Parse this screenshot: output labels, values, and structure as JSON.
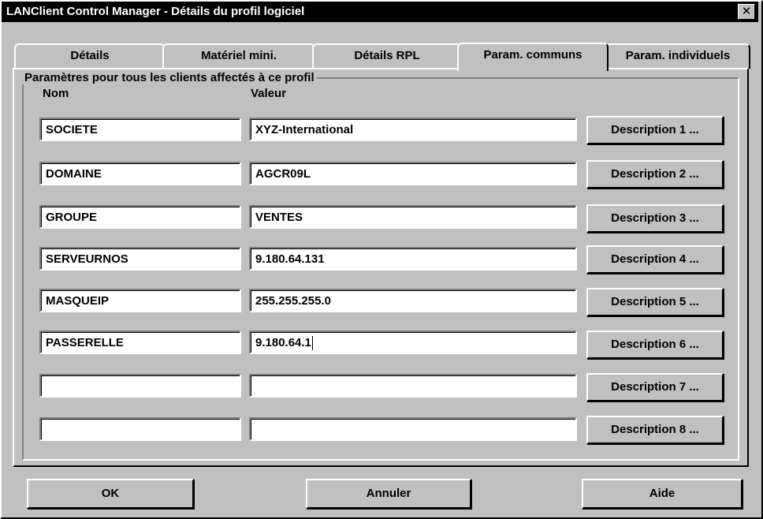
{
  "window": {
    "title": "LANClient Control Manager - Détails du profil logiciel",
    "close_glyph": "✕"
  },
  "tabs": [
    {
      "label": "Détails",
      "active": false
    },
    {
      "label": "Matériel mini.",
      "active": false
    },
    {
      "label": "Détails RPL",
      "active": false
    },
    {
      "label": "Param. communs",
      "active": true
    },
    {
      "label": "Param. individuels",
      "active": false
    }
  ],
  "group": {
    "label": "Paramètres pour tous les clients affectés à ce profil",
    "col_name": "Nom",
    "col_value": "Valeur"
  },
  "rows": [
    {
      "name": "SOCIETE",
      "value": "XYZ-International",
      "button": "Description 1 ..."
    },
    {
      "name": "DOMAINE",
      "value": "AGCR09L",
      "button": "Description 2 ..."
    },
    {
      "name": "GROUPE",
      "value": "VENTES",
      "button": "Description 3 ..."
    },
    {
      "name": "SERVEURNOS",
      "value": "9.180.64.131",
      "button": "Description 4 ..."
    },
    {
      "name": "MASQUEIP",
      "value": "255.255.255.0",
      "button": "Description 5 ..."
    },
    {
      "name": "PASSERELLE",
      "value": "9.180.64.1",
      "button": "Description 6 ..."
    },
    {
      "name": "",
      "value": "",
      "button": "Description 7 ..."
    },
    {
      "name": "",
      "value": "",
      "button": "Description 8 ..."
    }
  ],
  "buttons": {
    "ok": "OK",
    "cancel": "Annuler",
    "help": "Aide"
  }
}
